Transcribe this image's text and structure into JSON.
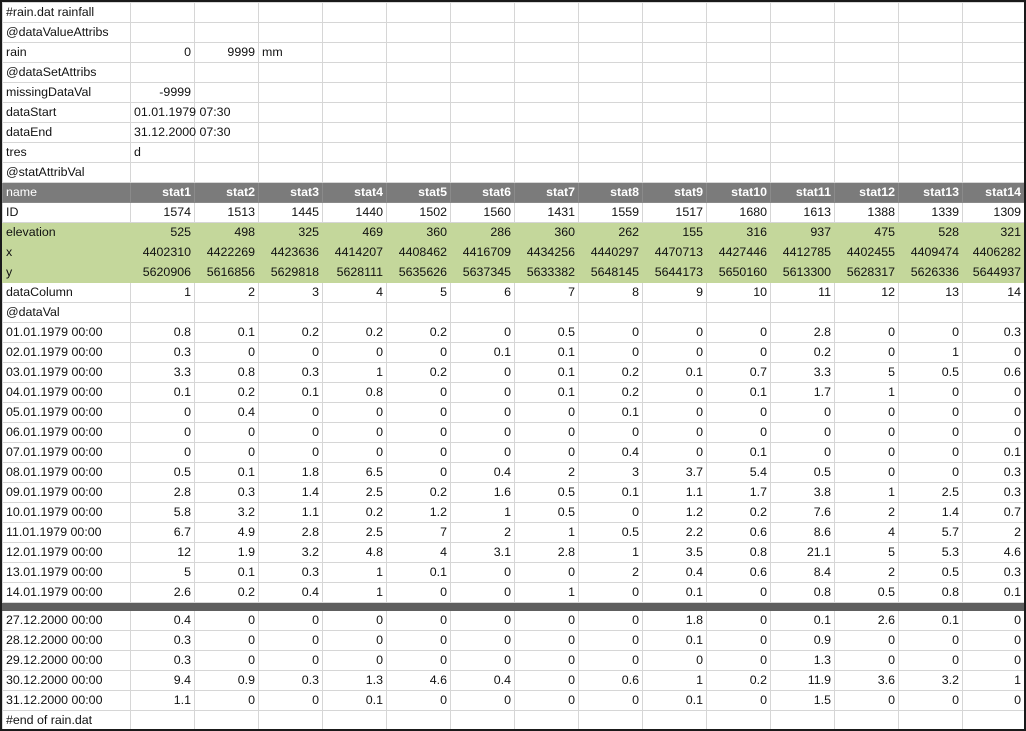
{
  "sheet": {
    "file_title": "#rain.dat rainfall",
    "value_attribs_tag": "@dataValueAttribs",
    "rain": {
      "label": "rain",
      "min": "0",
      "max": "9999",
      "unit": "mm"
    },
    "set_attribs_tag": "@dataSetAttribs",
    "missing": {
      "label": "missingDataVal",
      "value": "-9999"
    },
    "data_start": {
      "label": "dataStart",
      "value": "01.01.1979 07:30"
    },
    "data_end": {
      "label": "dataEnd",
      "value": "31.12.2000 07:30"
    },
    "tres": {
      "label": "tres",
      "value": "d"
    },
    "stat_attrib_tag": "@statAttribVal",
    "name_row": {
      "label": "name",
      "cells": [
        "stat1",
        "stat2",
        "stat3",
        "stat4",
        "stat5",
        "stat6",
        "stat7",
        "stat8",
        "stat9",
        "stat10",
        "stat11",
        "stat12",
        "stat13",
        "stat14"
      ]
    },
    "id_row": {
      "label": "ID",
      "cells": [
        "1574",
        "1513",
        "1445",
        "1440",
        "1502",
        "1560",
        "1431",
        "1559",
        "1517",
        "1680",
        "1613",
        "1388",
        "1339",
        "1309"
      ]
    },
    "elevation_row": {
      "label": "elevation",
      "cells": [
        "525",
        "498",
        "325",
        "469",
        "360",
        "286",
        "360",
        "262",
        "155",
        "316",
        "937",
        "475",
        "528",
        "321"
      ]
    },
    "x_row": {
      "label": "x",
      "cells": [
        "4402310",
        "4422269",
        "4423636",
        "4414207",
        "4408462",
        "4416709",
        "4434256",
        "4440297",
        "4470713",
        "4427446",
        "4412785",
        "4402455",
        "4409474",
        "4406282"
      ]
    },
    "y_row": {
      "label": "y",
      "cells": [
        "5620906",
        "5616856",
        "5629818",
        "5628111",
        "5635626",
        "5637345",
        "5633382",
        "5648145",
        "5644173",
        "5650160",
        "5613300",
        "5628317",
        "5626336",
        "5644937"
      ]
    },
    "data_column_row": {
      "label": "dataColumn",
      "cells": [
        "1",
        "2",
        "3",
        "4",
        "5",
        "6",
        "7",
        "8",
        "9",
        "10",
        "11",
        "12",
        "13",
        "14"
      ]
    },
    "data_val_tag": "@dataVal",
    "data_rows_top": [
      {
        "date": "01.01.1979 00:00",
        "values": [
          "0.8",
          "0.1",
          "0.2",
          "0.2",
          "0.2",
          "0",
          "0.5",
          "0",
          "0",
          "0",
          "2.8",
          "0",
          "0",
          "0.3"
        ]
      },
      {
        "date": "02.01.1979 00:00",
        "values": [
          "0.3",
          "0",
          "0",
          "0",
          "0",
          "0.1",
          "0.1",
          "0",
          "0",
          "0",
          "0.2",
          "0",
          "1",
          "0"
        ]
      },
      {
        "date": "03.01.1979 00:00",
        "values": [
          "3.3",
          "0.8",
          "0.3",
          "1",
          "0.2",
          "0",
          "0.1",
          "0.2",
          "0.1",
          "0.7",
          "3.3",
          "5",
          "0.5",
          "0.6"
        ]
      },
      {
        "date": "04.01.1979 00:00",
        "values": [
          "0.1",
          "0.2",
          "0.1",
          "0.8",
          "0",
          "0",
          "0.1",
          "0.2",
          "0",
          "0.1",
          "1.7",
          "1",
          "0",
          "0"
        ]
      },
      {
        "date": "05.01.1979 00:00",
        "values": [
          "0",
          "0.4",
          "0",
          "0",
          "0",
          "0",
          "0",
          "0.1",
          "0",
          "0",
          "0",
          "0",
          "0",
          "0"
        ]
      },
      {
        "date": "06.01.1979 00:00",
        "values": [
          "0",
          "0",
          "0",
          "0",
          "0",
          "0",
          "0",
          "0",
          "0",
          "0",
          "0",
          "0",
          "0",
          "0"
        ]
      },
      {
        "date": "07.01.1979 00:00",
        "values": [
          "0",
          "0",
          "0",
          "0",
          "0",
          "0",
          "0",
          "0.4",
          "0",
          "0.1",
          "0",
          "0",
          "0",
          "0.1"
        ]
      },
      {
        "date": "08.01.1979 00:00",
        "values": [
          "0.5",
          "0.1",
          "1.8",
          "6.5",
          "0",
          "0.4",
          "2",
          "3",
          "3.7",
          "5.4",
          "0.5",
          "0",
          "0",
          "0.3"
        ]
      },
      {
        "date": "09.01.1979 00:00",
        "values": [
          "2.8",
          "0.3",
          "1.4",
          "2.5",
          "0.2",
          "1.6",
          "0.5",
          "0.1",
          "1.1",
          "1.7",
          "3.8",
          "1",
          "2.5",
          "0.3"
        ]
      },
      {
        "date": "10.01.1979 00:00",
        "values": [
          "5.8",
          "3.2",
          "1.1",
          "0.2",
          "1.2",
          "1",
          "0.5",
          "0",
          "1.2",
          "0.2",
          "7.6",
          "2",
          "1.4",
          "0.7"
        ]
      },
      {
        "date": "11.01.1979 00:00",
        "values": [
          "6.7",
          "4.9",
          "2.8",
          "2.5",
          "7",
          "2",
          "1",
          "0.5",
          "2.2",
          "0.6",
          "8.6",
          "4",
          "5.7",
          "2"
        ]
      },
      {
        "date": "12.01.1979 00:00",
        "values": [
          "12",
          "1.9",
          "3.2",
          "4.8",
          "4",
          "3.1",
          "2.8",
          "1",
          "3.5",
          "0.8",
          "21.1",
          "5",
          "5.3",
          "4.6"
        ]
      },
      {
        "date": "13.01.1979 00:00",
        "values": [
          "5",
          "0.1",
          "0.3",
          "1",
          "0.1",
          "0",
          "0",
          "2",
          "0.4",
          "0.6",
          "8.4",
          "2",
          "0.5",
          "0.3"
        ]
      },
      {
        "date": "14.01.1979 00:00",
        "values": [
          "2.6",
          "0.2",
          "0.4",
          "1",
          "0",
          "0",
          "1",
          "0",
          "0.1",
          "0",
          "0.8",
          "0.5",
          "0.8",
          "0.1"
        ]
      }
    ],
    "data_rows_bottom": [
      {
        "date": "27.12.2000 00:00",
        "values": [
          "0.4",
          "0",
          "0",
          "0",
          "0",
          "0",
          "0",
          "0",
          "1.8",
          "0",
          "0.1",
          "2.6",
          "0.1",
          "0"
        ]
      },
      {
        "date": "28.12.2000 00:00",
        "values": [
          "0.3",
          "0",
          "0",
          "0",
          "0",
          "0",
          "0",
          "0",
          "0.1",
          "0",
          "0.9",
          "0",
          "0",
          "0"
        ]
      },
      {
        "date": "29.12.2000 00:00",
        "values": [
          "0.3",
          "0",
          "0",
          "0",
          "0",
          "0",
          "0",
          "0",
          "0",
          "0",
          "1.3",
          "0",
          "0",
          "0"
        ]
      },
      {
        "date": "30.12.2000 00:00",
        "values": [
          "9.4",
          "0.9",
          "0.3",
          "1.3",
          "4.6",
          "0.4",
          "0",
          "0.6",
          "1",
          "0.2",
          "11.9",
          "3.6",
          "3.2",
          "1"
        ]
      },
      {
        "date": "31.12.2000 00:00",
        "values": [
          "1.1",
          "0",
          "0",
          "0.1",
          "0",
          "0",
          "0",
          "0",
          "0.1",
          "0",
          "1.5",
          "0",
          "0",
          "0"
        ]
      }
    ],
    "end_tag": "#end of rain.dat",
    "colors": {
      "header_bg": "#7b7b7b",
      "header_text": "#ffffff",
      "station_attr_bg": "#c4d79b",
      "separator": "#5e5e5e",
      "gridline": "#d6d6d6"
    }
  }
}
